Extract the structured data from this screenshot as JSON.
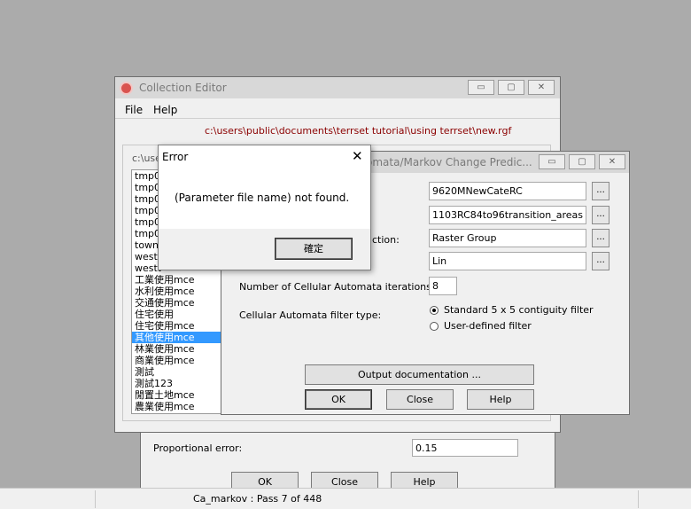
{
  "collection_editor": {
    "title": "Collection Editor",
    "menu": [
      "File",
      "Help"
    ],
    "file_path": "c:\\users\\public\\documents\\terrset tutorial\\using terrset\\new.rgf",
    "list_header_partial": "c:\\use",
    "list_items": [
      "tmp00",
      "tmp00",
      "tmp00",
      "tmp00",
      "tmp01",
      "tmp02",
      "towns",
      "weste",
      "westt",
      "工業使用mce",
      "水利使用mce",
      "交通使用mce",
      "住宅使用",
      "住宅使用mce",
      "其他使用mce",
      "林業使用mce",
      "商業使用mce",
      "測試",
      "測試123",
      "閒置土地mce",
      "農業使用mce"
    ],
    "selected_index": 14
  },
  "ca_markov": {
    "title_partial": "omata/Markov Change Predic...",
    "fields": {
      "basis_land_cover": "9620MNewCateRC",
      "transition_areas": "1103RC84to96transition_areas",
      "suitability_collection": "Raster Group",
      "output_name": "Lin",
      "iterations": "8"
    },
    "label_suitability_partial": "ction:",
    "label_iterations": "Number of Cellular Automata iterations:",
    "label_filter": "Cellular Automata filter type:",
    "filter_options": [
      "Standard 5 x 5 contiguity filter",
      "User-defined filter"
    ],
    "buttons": {
      "output_doc": "Output documentation ...",
      "ok": "OK",
      "close": "Close",
      "help": "Help"
    }
  },
  "back_dialog": {
    "proportional_error_label": "Proportional error:",
    "proportional_error_value": "0.15",
    "buttons": {
      "ok": "OK",
      "close": "Close",
      "help": "Help"
    }
  },
  "error_dialog": {
    "title": "Error",
    "message": "(Parameter file name) not found.",
    "ok_label": "確定"
  },
  "status_bar": {
    "text": "Ca_markov : Pass 7 of 448"
  },
  "window_controls": {
    "minimize": "▭",
    "maximize": "▢",
    "close": "✕"
  },
  "colors": {
    "selection": "#3399ff",
    "path_text": "#8b0000",
    "desktop": "#ababab"
  }
}
